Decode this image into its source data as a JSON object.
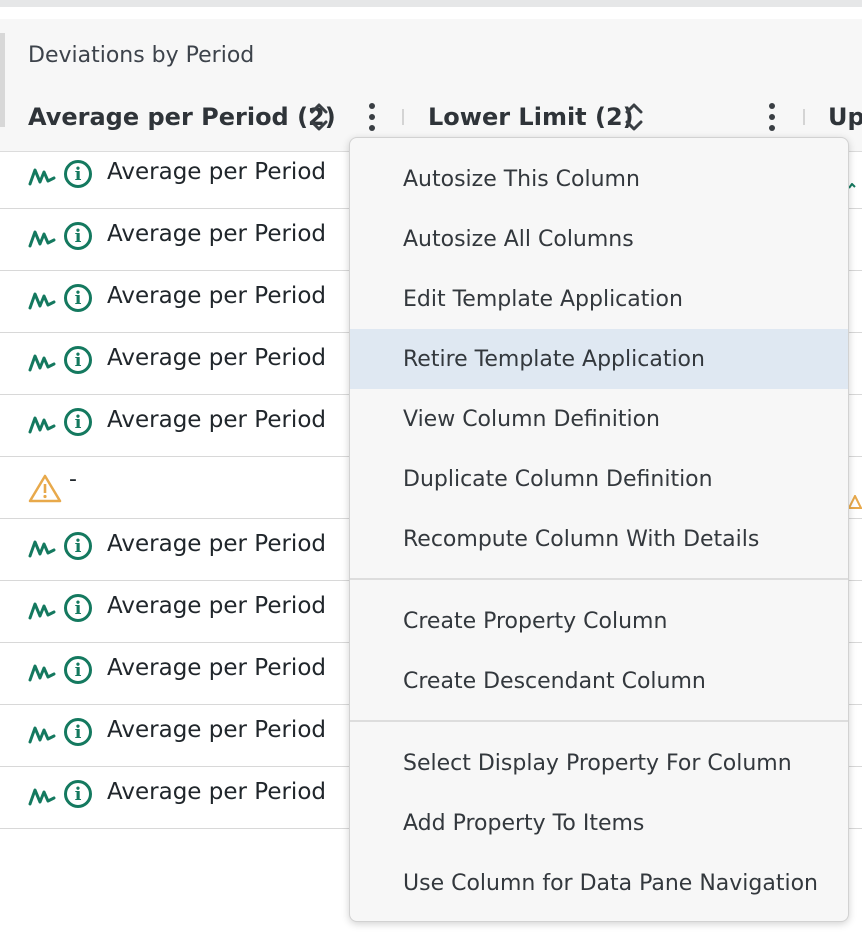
{
  "table": {
    "group_title": "Deviations by Period",
    "columns": [
      {
        "label": "Average per Period (2)"
      },
      {
        "label": "Lower Limit (2)"
      },
      {
        "label": "Up"
      }
    ],
    "rows": [
      {
        "type": "value",
        "text": "Average per Period"
      },
      {
        "type": "value",
        "text": "Average per Period"
      },
      {
        "type": "value",
        "text": "Average per Period"
      },
      {
        "type": "value",
        "text": "Average per Period"
      },
      {
        "type": "value",
        "text": "Average per Period"
      },
      {
        "type": "warning",
        "text": "-"
      },
      {
        "type": "value",
        "text": "Average per Period"
      },
      {
        "type": "value",
        "text": "Average per Period"
      },
      {
        "type": "value",
        "text": "Average per Period"
      },
      {
        "type": "value",
        "text": "Average per Period"
      },
      {
        "type": "value",
        "text": "Average per Period"
      }
    ]
  },
  "context_menu": {
    "groups": [
      [
        "Autosize This Column",
        "Autosize All Columns",
        "Edit Template Application",
        "Retire Template Application",
        "View Column Definition",
        "Duplicate Column Definition",
        "Recompute Column With Details"
      ],
      [
        "Create Property Column",
        "Create Descendant Column"
      ],
      [
        "Select Display Property For Column",
        "Add Property To Items",
        "Use Column for Data Pane Navigation"
      ]
    ],
    "highlighted_item": "Retire Template Application"
  },
  "colors": {
    "accent_green": "#14795f",
    "warning_orange": "#e8a94b",
    "highlight": "#dfe8f2"
  },
  "icons": {
    "signal": "signal-wave-icon",
    "info": "info-icon",
    "warning": "warning-triangle-icon",
    "sort": "sort-chevrons-icon",
    "menu": "vertical-ellipsis-icon"
  }
}
